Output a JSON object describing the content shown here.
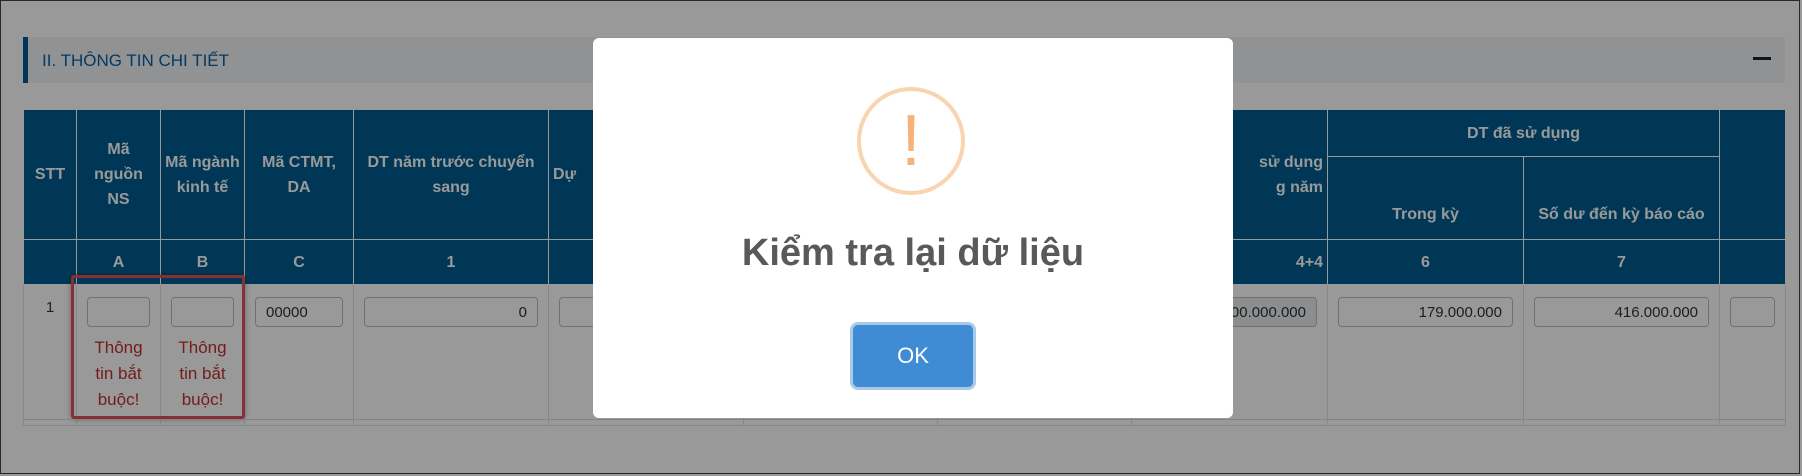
{
  "section": {
    "title": "II. THÔNG TIN CHI TIẾT",
    "collapse_icon": "minus-icon"
  },
  "table": {
    "group_header": "DT đã sử dụng",
    "headers": {
      "stt": "STT",
      "ma_nguon": "Mã nguồn NS",
      "ma_nganh": "Mã ngành kinh tế",
      "ma_ctmt": "Mã CTMT, DA",
      "dt_nam_truoc": "DT năm trước chuyển sang",
      "du_partial": "Dự",
      "su_dung_partial": "sử dụng\ng năm",
      "trong_ky": "Trong kỳ",
      "so_du": "Số dư đến kỳ báo cáo"
    },
    "codes": {
      "a": "A",
      "b": "B",
      "c": "C",
      "one": "1",
      "four_partial": "4+4",
      "six": "6",
      "seven": "7"
    },
    "row": {
      "stt": "1",
      "ma_nguon_value": "",
      "ma_nganh_value": "",
      "ma_ctmt_value": "00000",
      "dt_nam_truoc_value": "0",
      "su_dung_value": "00.000.000",
      "trong_ky_value": "179.000.000",
      "so_du_value": "416.000.000",
      "error_text": "Thông tin bắt buộc!"
    }
  },
  "modal": {
    "icon": "warning-icon",
    "icon_glyph": "!",
    "title": "Kiểm tra lại dữ liệu",
    "ok_label": "OK"
  },
  "colors": {
    "header_bg": "#005d8f",
    "accent": "#0a5fa2",
    "error": "#c0312f",
    "ok_button": "#3f8bd4",
    "warning": "#f7b27a"
  }
}
